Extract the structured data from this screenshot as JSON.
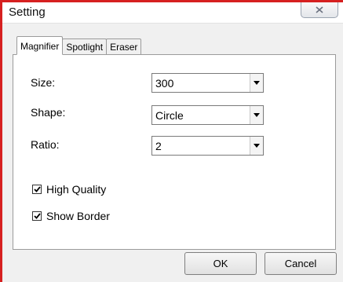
{
  "window": {
    "title": "Setting"
  },
  "tabs": [
    {
      "label": "Magnifier",
      "active": true
    },
    {
      "label": "Spotlight",
      "active": false
    },
    {
      "label": "Eraser",
      "active": false
    }
  ],
  "magnifier": {
    "size": {
      "label": "Size:",
      "value": "300"
    },
    "shape": {
      "label": "Shape:",
      "value": "Circle"
    },
    "ratio": {
      "label": "Ratio:",
      "value": "2"
    },
    "high_quality": {
      "label": "High Quality",
      "checked": true
    },
    "show_border": {
      "label": "Show Border",
      "checked": true
    }
  },
  "buttons": {
    "ok": "OK",
    "cancel": "Cancel"
  },
  "colors": {
    "window_frame_accent": "#d62020",
    "panel_bg": "#ffffff",
    "dialog_bg": "#f0f0f0"
  },
  "icons": {
    "close": "close-icon",
    "dropdown": "chevron-down-icon",
    "check": "check-icon"
  }
}
